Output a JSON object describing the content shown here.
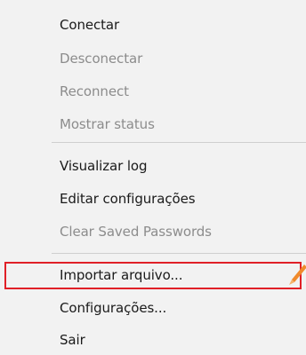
{
  "menu": {
    "items": [
      {
        "label": "Conectar",
        "enabled": true
      },
      {
        "label": "Desconectar",
        "enabled": false
      },
      {
        "label": "Reconnect",
        "enabled": false
      },
      {
        "label": "Mostrar status",
        "enabled": false
      },
      {
        "label": "Visualizar log",
        "enabled": true
      },
      {
        "label": "Editar configurações",
        "enabled": true
      },
      {
        "label": "Clear Saved Passwords",
        "enabled": false
      },
      {
        "label": "Importar arquivo...",
        "enabled": true,
        "highlighted": true
      },
      {
        "label": "Configurações...",
        "enabled": true
      },
      {
        "label": "Sair",
        "enabled": true
      }
    ]
  },
  "colors": {
    "menu_background": "#f2f2f2",
    "enabled_text": "#1a1a1a",
    "disabled_text": "#8c8c8c",
    "highlight_border": "#e02027",
    "annotation_pencil": "#f08a2c"
  },
  "annotation": {
    "icon": "pencil-icon"
  }
}
